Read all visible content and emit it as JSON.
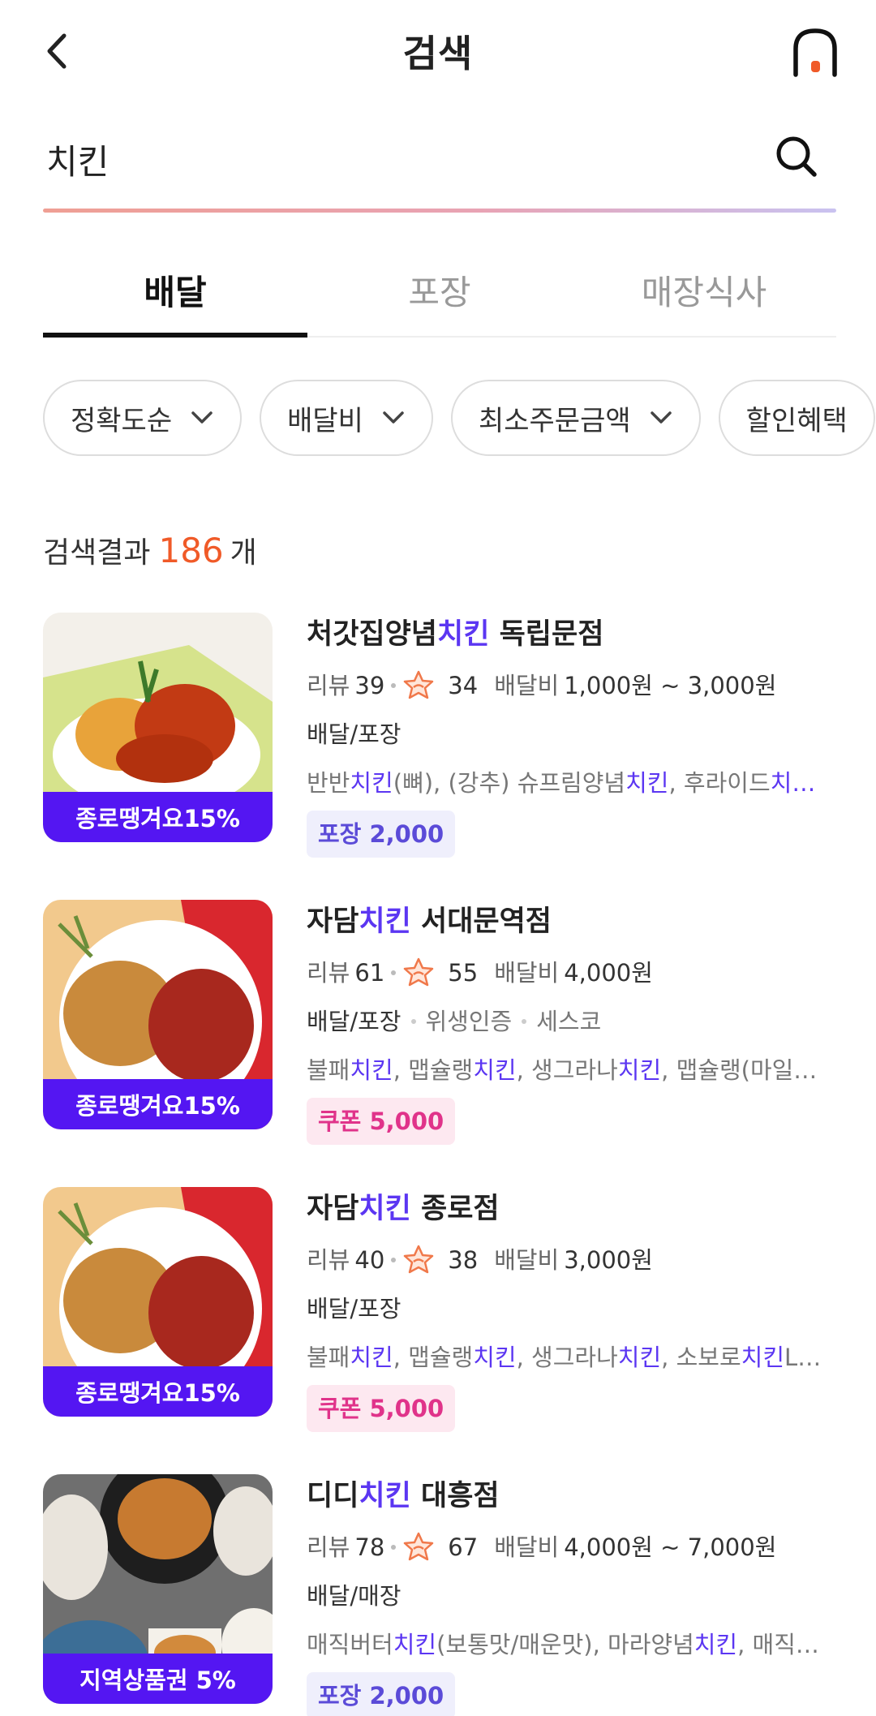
{
  "header": {
    "title": "검색"
  },
  "search": {
    "query": "치킨"
  },
  "tabs": [
    {
      "label": "배달",
      "active": true
    },
    {
      "label": "포장",
      "active": false
    },
    {
      "label": "매장식사",
      "active": false
    }
  ],
  "filters": [
    {
      "label": "정확도순",
      "dropdown": true
    },
    {
      "label": "배달비",
      "dropdown": true
    },
    {
      "label": "최소주문금액",
      "dropdown": true
    },
    {
      "label": "할인혜택",
      "dropdown": false
    }
  ],
  "results": {
    "prefix": "검색결과",
    "count": "186",
    "suffix": "개"
  },
  "colors": {
    "accent": "#5b36f2",
    "promo": "#5416f2",
    "count": "#f05a28",
    "coupon": "#e0338a"
  },
  "stores": [
    {
      "name_pre": "처갓집양념",
      "name_hl": "치킨",
      "name_post": " 독립문점",
      "review_label": "리뷰",
      "reviews": "39",
      "rating": "34",
      "fee_label": "배달비",
      "fee": "1,000원 ~ 3,000원",
      "type": "배달/포장",
      "tags": [],
      "menu": [
        [
          "반반",
          ""
        ],
        [
          "치킨",
          "hl"
        ],
        [
          "(뼈), (강추) 슈프림양념",
          ""
        ],
        [
          "치킨",
          "hl"
        ],
        [
          ", 후라이드",
          ""
        ],
        [
          "치…",
          "hl"
        ]
      ],
      "badge": "포장 2,000",
      "badge_kind": "takeout",
      "promo": "종로땡겨요15%"
    },
    {
      "name_pre": "자담",
      "name_hl": "치킨",
      "name_post": " 서대문역점",
      "review_label": "리뷰",
      "reviews": "61",
      "rating": "55",
      "fee_label": "배달비",
      "fee": "4,000원",
      "type": "배달/포장",
      "tags": [
        "위생인증",
        "세스코"
      ],
      "menu": [
        [
          "불패",
          ""
        ],
        [
          "치킨",
          "hl"
        ],
        [
          ", 맵슐랭",
          ""
        ],
        [
          "치킨",
          "hl"
        ],
        [
          ", 생그라나",
          ""
        ],
        [
          "치킨",
          "hl"
        ],
        [
          ", 맵슐랭(마일…",
          ""
        ]
      ],
      "badge": "쿠폰 5,000",
      "badge_kind": "coupon",
      "promo": "종로땡겨요15%"
    },
    {
      "name_pre": "자담",
      "name_hl": "치킨",
      "name_post": " 종로점",
      "review_label": "리뷰",
      "reviews": "40",
      "rating": "38",
      "fee_label": "배달비",
      "fee": "3,000원",
      "type": "배달/포장",
      "tags": [],
      "menu": [
        [
          "불패",
          ""
        ],
        [
          "치킨",
          "hl"
        ],
        [
          ", 맵슐랭",
          ""
        ],
        [
          "치킨",
          "hl"
        ],
        [
          ", 생그라나",
          ""
        ],
        [
          "치킨",
          "hl"
        ],
        [
          ", 소보로",
          ""
        ],
        [
          "치킨",
          "hl"
        ],
        [
          "L(…",
          ""
        ]
      ],
      "badge": "쿠폰 5,000",
      "badge_kind": "coupon",
      "promo": "종로땡겨요15%"
    },
    {
      "name_pre": "디디",
      "name_hl": "치킨",
      "name_post": " 대흥점",
      "review_label": "리뷰",
      "reviews": "78",
      "rating": "67",
      "fee_label": "배달비",
      "fee": "4,000원 ~ 7,000원",
      "type": "배달/매장",
      "tags": [],
      "menu": [
        [
          "매직버터",
          ""
        ],
        [
          "치킨",
          "hl"
        ],
        [
          "(보통맛/매운맛), 마라양념",
          ""
        ],
        [
          "치킨",
          "hl"
        ],
        [
          ", 매직…",
          ""
        ]
      ],
      "badge": "포장 2,000",
      "badge_kind": "takeout",
      "promo": "지역상품권 5%"
    }
  ]
}
